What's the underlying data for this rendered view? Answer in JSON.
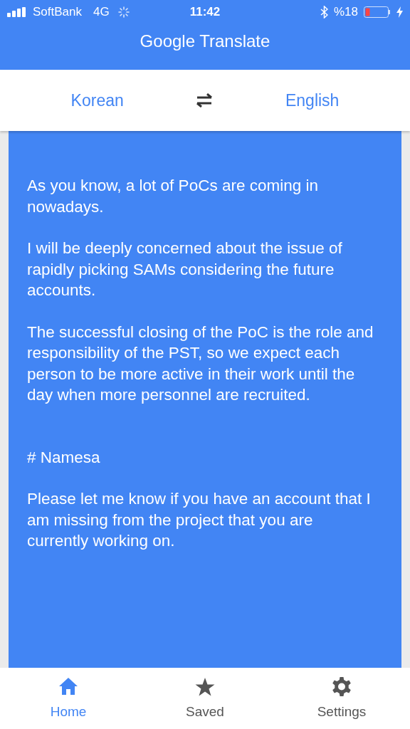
{
  "status_bar": {
    "carrier": "SoftBank",
    "network": "4G",
    "time": "11:42",
    "battery": "%18"
  },
  "app_bar": {
    "title": "Google Translate"
  },
  "languages": {
    "source": "Korean",
    "target": "English"
  },
  "translation": {
    "paragraphs": [
      "As you know, a lot of PoCs are coming in nowadays.",
      "I will be deeply concerned about the issue of rapidly picking SAMs considering the future accounts.",
      "The successful closing of the PoC is the role and responsibility of the PST, so we expect each person to be more active in their work until the day when more personnel are recruited.",
      "# Namesa",
      "Please let me know if you have an account that I am missing from the project that you are currently working on."
    ]
  },
  "bottom_nav": [
    {
      "kind": "home",
      "label": "Home",
      "selected": true
    },
    {
      "kind": "saved",
      "label": "Saved",
      "selected": false
    },
    {
      "kind": "settings",
      "label": "Settings",
      "selected": false
    }
  ]
}
